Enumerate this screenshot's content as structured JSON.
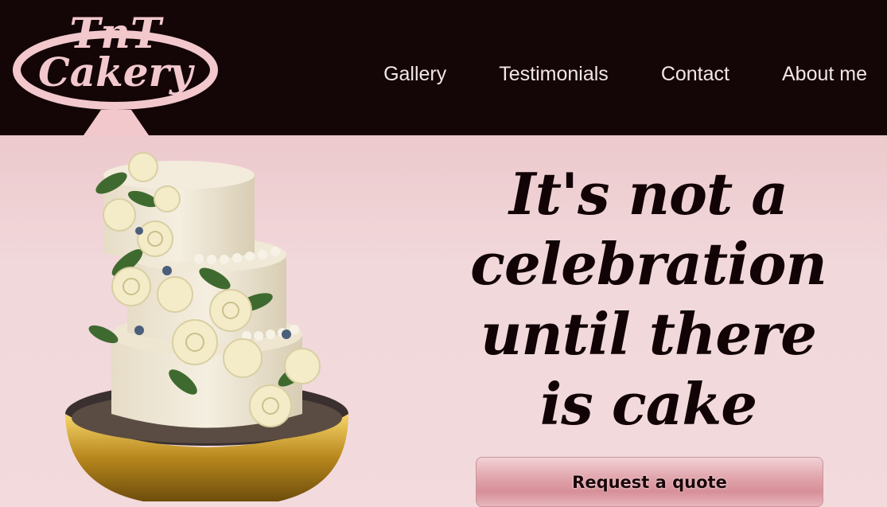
{
  "brand": {
    "logo_line1": "TnT",
    "logo_line2": "Cakery",
    "logo_color": "#f2c8cd",
    "navbar_bg": "#140507"
  },
  "nav": {
    "items": [
      {
        "label": "Gallery"
      },
      {
        "label": "Testimonials"
      },
      {
        "label": "Contact"
      },
      {
        "label": "About me"
      }
    ]
  },
  "hero": {
    "headline": "It's not a celebration until there is cake",
    "cta_label": "Request a quote",
    "image": "tiered-wedding-cake-with-roses"
  }
}
